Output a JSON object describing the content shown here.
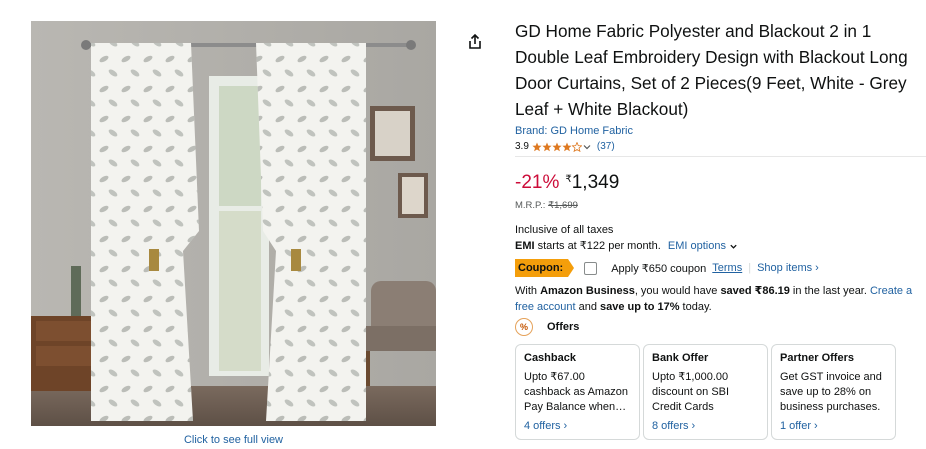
{
  "image": {
    "full_view_label": "Click to see full view"
  },
  "product": {
    "title": "GD Home Fabric Polyester and Blackout 2 in 1 Double Leaf Embroidery Design with Blackout Long Door Curtains, Set of 2 Pieces(9 Feet, White - Grey Leaf + White Blackout)",
    "brand": "Brand: GD Home Fabric",
    "rating": "3.9",
    "rating_stars": 3.9,
    "rating_count": "(37)"
  },
  "price": {
    "discount": "-21%",
    "currency": "₹",
    "amount": "1,349",
    "mrp_label": "M.R.P.:",
    "mrp_value": "₹1,699",
    "taxes": "Inclusive of all taxes",
    "emi_label": "EMI",
    "emi_text": " starts at ₹122 per month.",
    "emi_options": "EMI options"
  },
  "coupon": {
    "badge": "Coupon:",
    "apply_text": "Apply ₹650 coupon",
    "terms": "Terms",
    "separator": "|",
    "shop_items": "Shop items ›"
  },
  "business": {
    "prefix": "With ",
    "brand": "Amazon Business",
    "mid1": ", you would have ",
    "saved": "saved ₹86.19",
    "mid2": " in the last year. ",
    "create": "Create a free account",
    "mid3": " and ",
    "save_up": "save up to 17%",
    "suffix": " today."
  },
  "offers": {
    "heading": "Offers",
    "icon_text": "%",
    "cards": [
      {
        "title": "Cashback",
        "body": "Upto ₹67.00 cashback as Amazon Pay Balance when…",
        "more": "4 offers ›"
      },
      {
        "title": "Bank Offer",
        "body": "Upto ₹1,000.00 discount on SBI Credit Cards",
        "more": "8 offers ›"
      },
      {
        "title": "Partner Offers",
        "body": "Get GST invoice and save up to 28% on business purchases.",
        "more": "1 offer ›"
      }
    ]
  }
}
